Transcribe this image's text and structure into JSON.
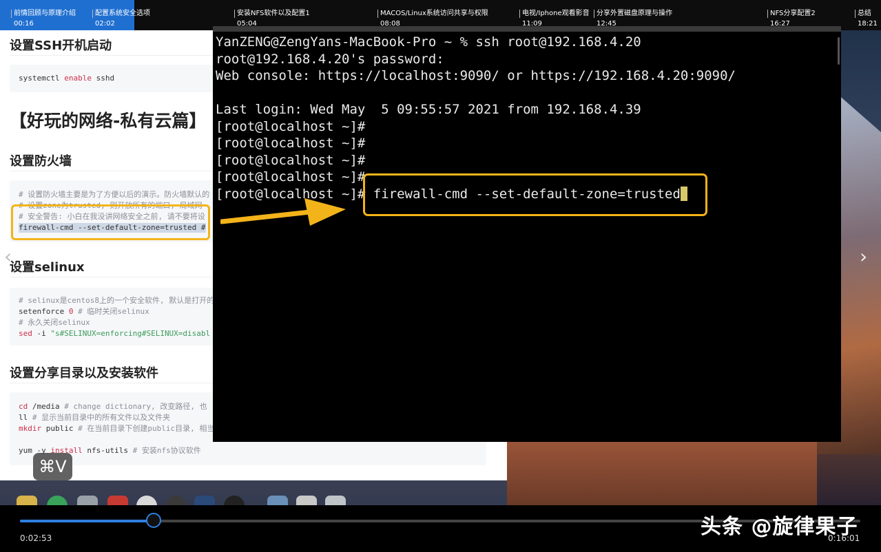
{
  "chapters": [
    {
      "title": "前情回顾与原理介绍",
      "time": "00:16"
    },
    {
      "title": "配置系统安全选项",
      "time": "02:02"
    },
    {
      "title": "安装NFS软件以及配置1",
      "time": "05:04"
    },
    {
      "title": "MACOS/Linux系统访问共享与权限",
      "time": "08:08"
    },
    {
      "title": "电视/Iphone观看影音",
      "time": "11:09"
    },
    {
      "title": "分享外置磁盘原理与操作",
      "time": "12:45"
    },
    {
      "title": "NFS分享配置2",
      "time": "16:27"
    },
    {
      "title": "总结",
      "time": "18:21"
    }
  ],
  "doc": {
    "h_ssh": "设置SSH开机启动",
    "ssh_code": {
      "cmd": "systemctl",
      "kw": "enable",
      "arg": "sshd"
    },
    "h_big": "【好玩的网络-私有云篇】",
    "h_firewall": "设置防火墙",
    "fw_lines": [
      "# 设置防火墙主要是为了方便以后的演示。防火墙默认的",
      "# 设置zone为trusted, 则开放所有的端口, 局域网",
      "# 安全警告: 小白在我没讲网络安全之前, 请不要将设",
      "firewall-cmd --set-default-zone=trusted #"
    ],
    "h_selinux": "设置selinux",
    "se_lines": {
      "l1": "# selinux是centos8上的一个安全软件, 默认是打开的",
      "l2_cmd": "setenforce",
      "l2_num": "0",
      "l2_cm": "# 临时关闭selinux",
      "l3": "# 永久关闭selinux",
      "l4_kw": "sed",
      "l4_opt": "-i",
      "l4_str": "\"s#SELINUX=enforcing#SELINUX=disabl"
    },
    "h_share": "设置分享目录以及安装软件",
    "share_lines": {
      "l1_kw": "cd",
      "l1_arg": "/media",
      "l1_cm": "# change dictionary, 改变路径, 也",
      "l2_kw": "ll",
      "l2_cm": "# 显示当前目录中的所有文件以及文件夹",
      "l3_kw": "mkdir",
      "l3_arg": "public",
      "l3_cm": "# 在当前目录下创建public目录, 相当",
      "l4_a": "yum",
      "l4_b": "-y",
      "l4_kw": "install",
      "l4_arg": "nfs-utils",
      "l4_cm": "# 安装nfs协议软件"
    },
    "prev_arrow": "‹",
    "next_arrow": "›"
  },
  "terminal": {
    "lines": [
      "YanZENG@ZengYans-MacBook-Pro ~ % ssh root@192.168.4.20",
      "root@192.168.4.20's password:",
      "Web console: https://localhost:9090/ or https://192.168.4.20:9090/",
      "",
      "Last login: Wed May  5 09:55:57 2021 from 192.168.4.39",
      "[root@localhost ~]#",
      "[root@localhost ~]#",
      "[root@localhost ~]#",
      "[root@localhost ~]#"
    ],
    "prompt": "[root@localhost ~]# ",
    "command": "firewall-cmd --set-default-zone=trusted"
  },
  "keyboard_hint": "⌘V",
  "player": {
    "current_time": "0:02:53",
    "total_time": "0:16:01",
    "progress": 0.16
  },
  "watermark": "头条 @旋律果子",
  "colors": {
    "highlight": "#f3b41a",
    "progress": "#2f7fe0",
    "chapter_active": "#1f6fd1"
  }
}
